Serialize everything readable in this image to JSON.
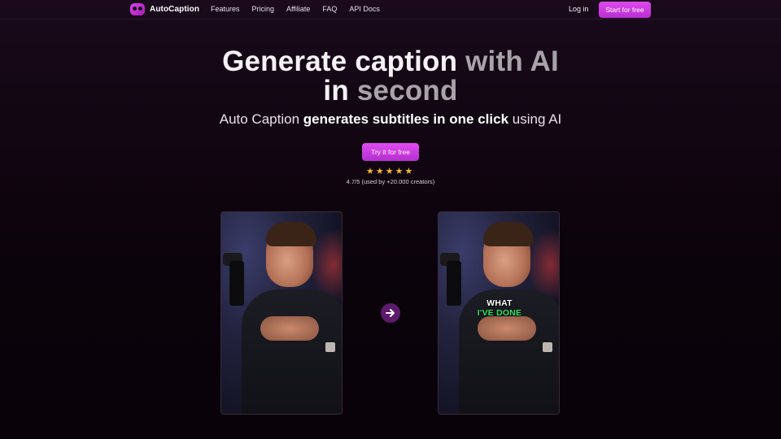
{
  "nav": {
    "brand": "AutoCaption",
    "links": [
      "Features",
      "Pricing",
      "Affiliate",
      "FAQ",
      "API Docs"
    ],
    "login": "Log in",
    "cta": "Start for free"
  },
  "hero": {
    "title_white_1": "Generate caption",
    "title_grey_1": "with AI",
    "title_white_2": "in",
    "title_grey_2": "second",
    "sub_plain_1": "Auto Caption",
    "sub_bold_1": "generates subtitles in one click",
    "sub_plain_2": "using AI",
    "cta": "Try it for free",
    "stars": [
      "★",
      "★",
      "★",
      "★",
      "★"
    ],
    "rating": "4.7/5 (used by +20.000 creators)"
  },
  "demo": {
    "caption_line_1": "WHAT",
    "caption_line_2": "I'VE DONE",
    "arrow_icon": "arrow-right-icon"
  },
  "colors": {
    "accent": "#d946ef",
    "caption_green": "#2ee86a",
    "star": "#f5b731"
  }
}
